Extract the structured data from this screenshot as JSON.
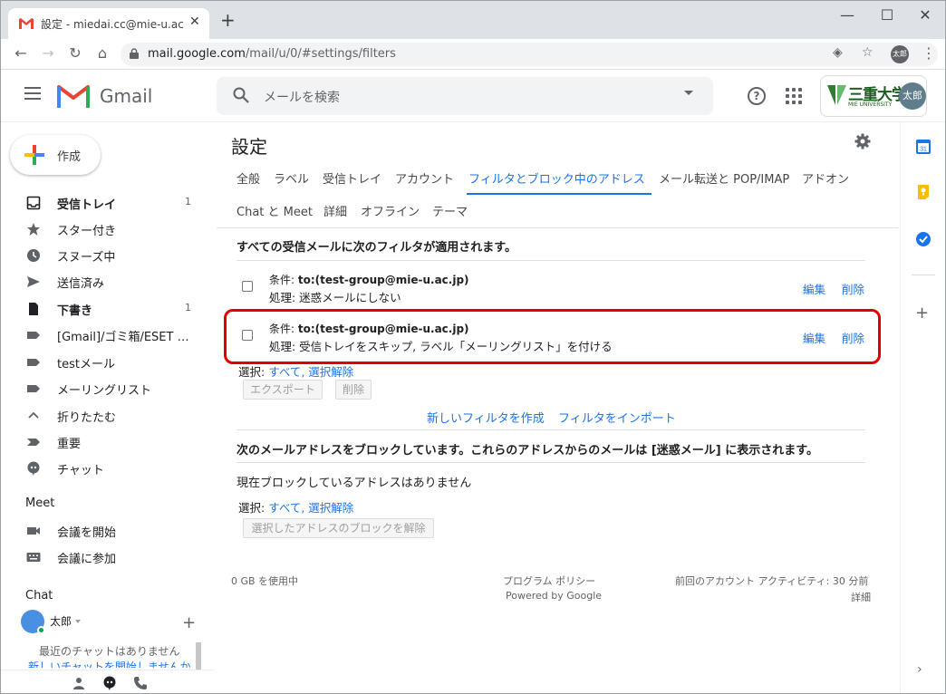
{
  "browser": {
    "tab_title": "設定 - miedai.cc@mie-u.ac.jp - 三",
    "tab_close": "✕",
    "new_tab": "+",
    "url_host": "mail.google.com",
    "url_path": "/mail/u/0/#settings/filters",
    "profile_label": "太郎",
    "window_minimize": "—",
    "window_maximize": "☐",
    "window_close": "✕"
  },
  "header": {
    "app_name": "Gmail",
    "search_placeholder": "メールを検索",
    "help": "?",
    "org_name": "三重大学",
    "org_name_en": "MIE UNIVERSITY",
    "avatar_label": "太郎"
  },
  "sidebar": {
    "compose_label": "作成",
    "items": [
      {
        "label": "受信トレイ",
        "count": "1",
        "bold": true
      },
      {
        "label": "スター付き",
        "count": ""
      },
      {
        "label": "スヌーズ中",
        "count": ""
      },
      {
        "label": "送信済み",
        "count": ""
      },
      {
        "label": "下書き",
        "count": "1",
        "bold": true
      },
      {
        "label": "[Gmail]/ゴミ箱/ESET An...",
        "count": ""
      },
      {
        "label": "testメール",
        "count": ""
      },
      {
        "label": "メーリングリスト",
        "count": ""
      },
      {
        "label": "折りたたむ",
        "count": ""
      },
      {
        "label": "重要",
        "count": ""
      },
      {
        "label": "チャット",
        "count": ""
      }
    ],
    "meet_heading": "Meet",
    "meet_items": [
      "会議を開始",
      "会議に参加"
    ],
    "chat_heading": "Chat",
    "chat_user": "太郎",
    "chat_add": "+",
    "no_chats": "最近のチャットはありません",
    "start_chat": "新しいチャットを開始しませんか"
  },
  "settings": {
    "title": "設定",
    "tabs_row1": [
      "全般",
      "ラベル",
      "受信トレイ",
      "アカウント",
      "フィルタとブロック中のアドレス",
      "メール転送と POP/IMAP",
      "アドオン"
    ],
    "tabs_row2": [
      "Chat と Meet",
      "詳細",
      "オフライン",
      "テーマ"
    ],
    "filters_heading": "すべての受信メールに次のフィルタが適用されます。",
    "condition_prefix": "条件: ",
    "filters": [
      {
        "condition": "to:(test-group@mie-u.ac.jp)",
        "action": "処理: 迷惑メールにしない",
        "edit": "編集",
        "delete": "削除"
      },
      {
        "condition": "to:(test-group@mie-u.ac.jp)",
        "action": "処理: 受信トレイをスキップ, ラベル「メーリングリスト」を付ける",
        "edit": "編集",
        "delete": "削除"
      }
    ],
    "select_label": "選択: ",
    "select_all": "すべて",
    "select_comma": ",",
    "select_none": "選択解除",
    "export_btn": "エクスポート",
    "delete_btn": "削除",
    "create_filter": "新しいフィルタを作成",
    "import_filter": "フィルタをインポート",
    "blocked_heading": "次のメールアドレスをブロックしています。これらのアドレスからのメールは [迷惑メール] に表示されます。",
    "no_blocked": "現在ブロックしているアドレスはありません",
    "unblock_btn": "選択したアドレスのブロックを解除"
  },
  "footer": {
    "storage": "0 GB を使用中",
    "policy": "プログラム ポリシー",
    "powered": "Powered by Google",
    "activity": "前回のアカウント アクティビティ: 30 分前",
    "details": "詳細"
  },
  "rail": {
    "calendar_day": "31",
    "add": "+",
    "expand": "›"
  },
  "colors": {
    "accent": "#1a73e8",
    "highlight": "#e00000",
    "gmail_red": "#ea4335"
  }
}
